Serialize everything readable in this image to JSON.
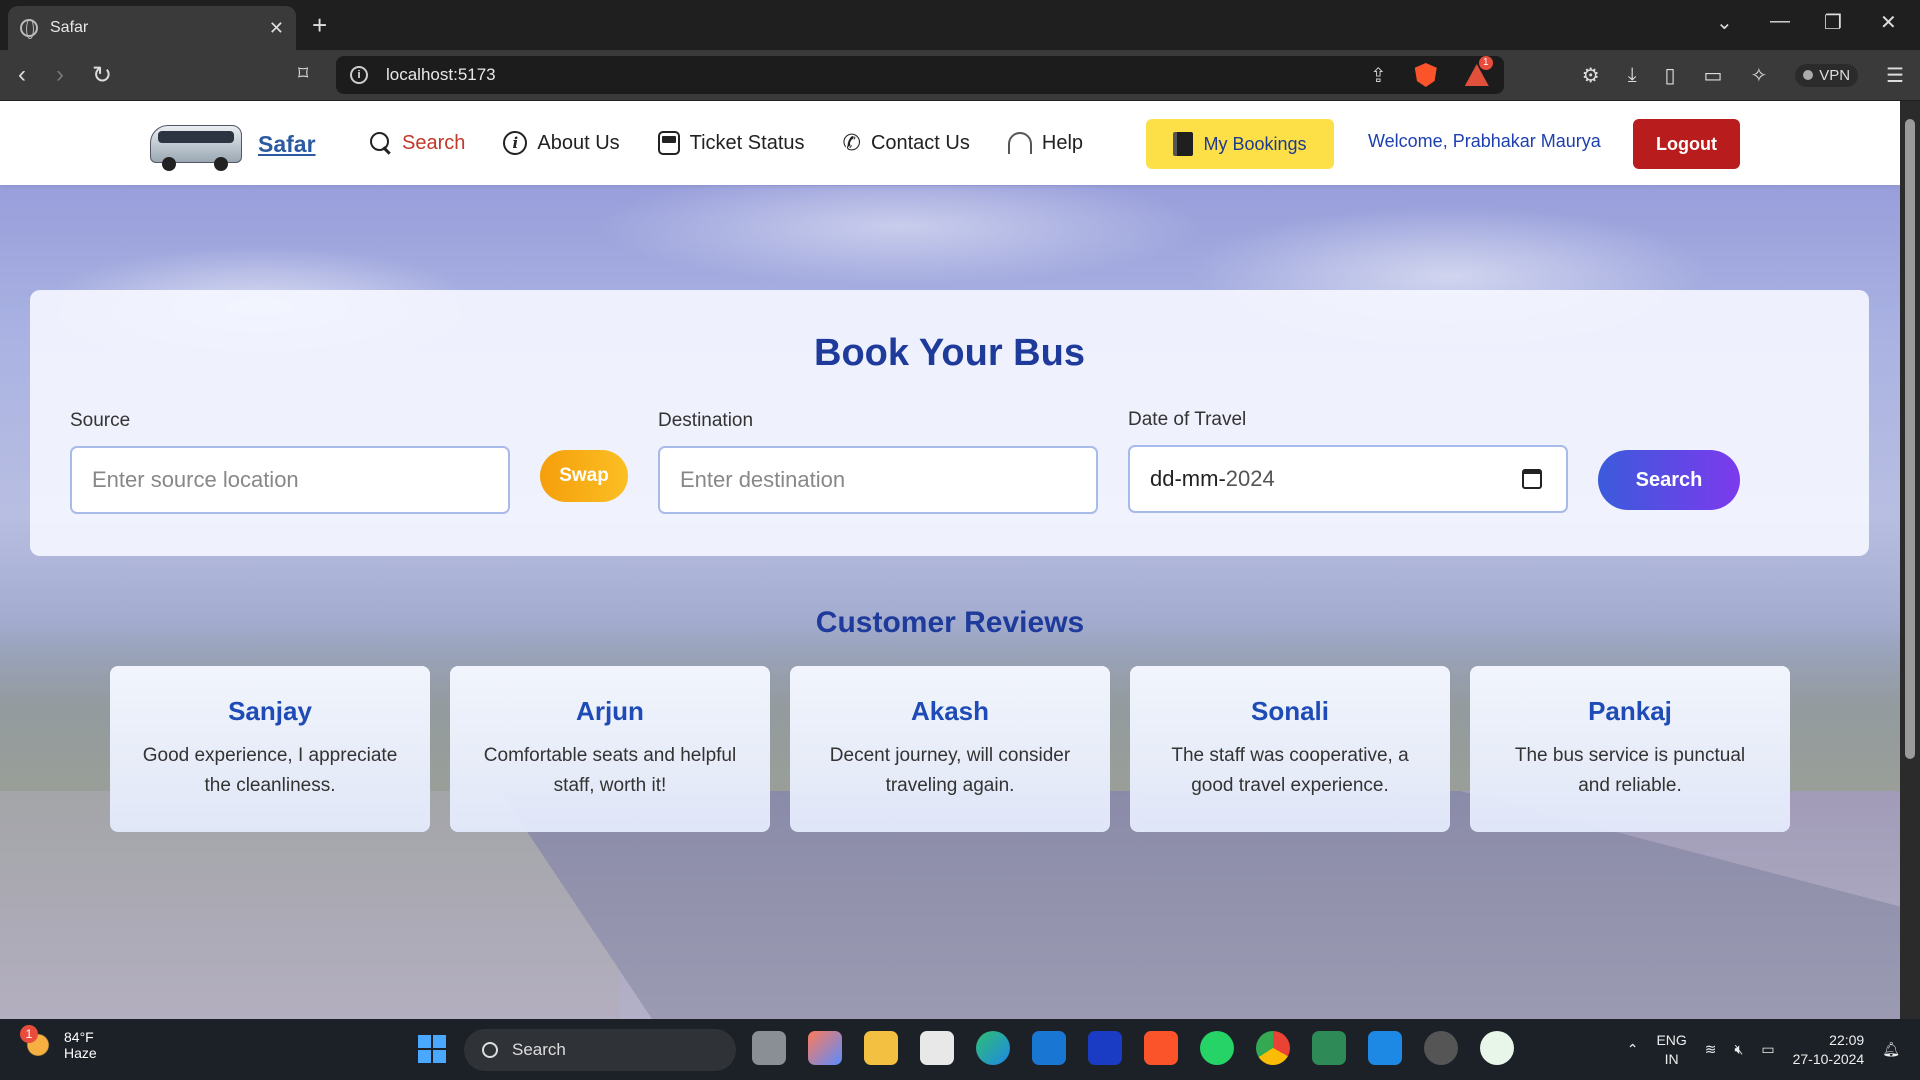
{
  "browser": {
    "tab_title": "Safar",
    "tab_close": "✕",
    "new_tab": "+",
    "url": "localhost:5173",
    "vpn_label": "VPN",
    "notification_count": "1"
  },
  "navbar": {
    "brand": "Safar",
    "items": [
      {
        "label": "Search",
        "icon": "search-icon",
        "active": true
      },
      {
        "label": "About Us",
        "icon": "info-icon"
      },
      {
        "label": "Ticket Status",
        "icon": "bus-icon"
      },
      {
        "label": "Contact Us",
        "icon": "phone-icon"
      },
      {
        "label": "Help",
        "icon": "headset-icon"
      }
    ],
    "bookings_label": "My Bookings",
    "welcome": "Welcome, Prabhakar Maurya",
    "logout_label": "Logout"
  },
  "booking": {
    "title": "Book Your Bus",
    "source_label": "Source",
    "source_placeholder": "Enter source location",
    "swap_label": "Swap",
    "destination_label": "Destination",
    "destination_placeholder": "Enter destination",
    "date_label": "Date of Travel",
    "date_dm": "dd-mm-",
    "date_year": "2024",
    "search_label": "Search"
  },
  "reviews": {
    "title": "Customer Reviews",
    "items": [
      {
        "name": "Sanjay",
        "text": "Good experience, I appreciate the cleanliness."
      },
      {
        "name": "Arjun",
        "text": "Comfortable seats and helpful staff, worth it!"
      },
      {
        "name": "Akash",
        "text": "Decent journey, will consider traveling again."
      },
      {
        "name": "Sonali",
        "text": "The staff was cooperative, a good travel experience."
      },
      {
        "name": "Pankaj",
        "text": "The bus service is punctual and reliable."
      }
    ]
  },
  "taskbar": {
    "weather_temp": "84°F",
    "weather_desc": "Haze",
    "weather_badge": "1",
    "search_label": "Search",
    "lang_top": "ENG",
    "lang_bottom": "IN",
    "time": "22:09",
    "date": "27-10-2024"
  },
  "colors": {
    "accent": "#1e3a9a",
    "active_nav": "#c0392b",
    "bookings_bg": "#fde047",
    "logout_bg": "#b91c1c"
  }
}
